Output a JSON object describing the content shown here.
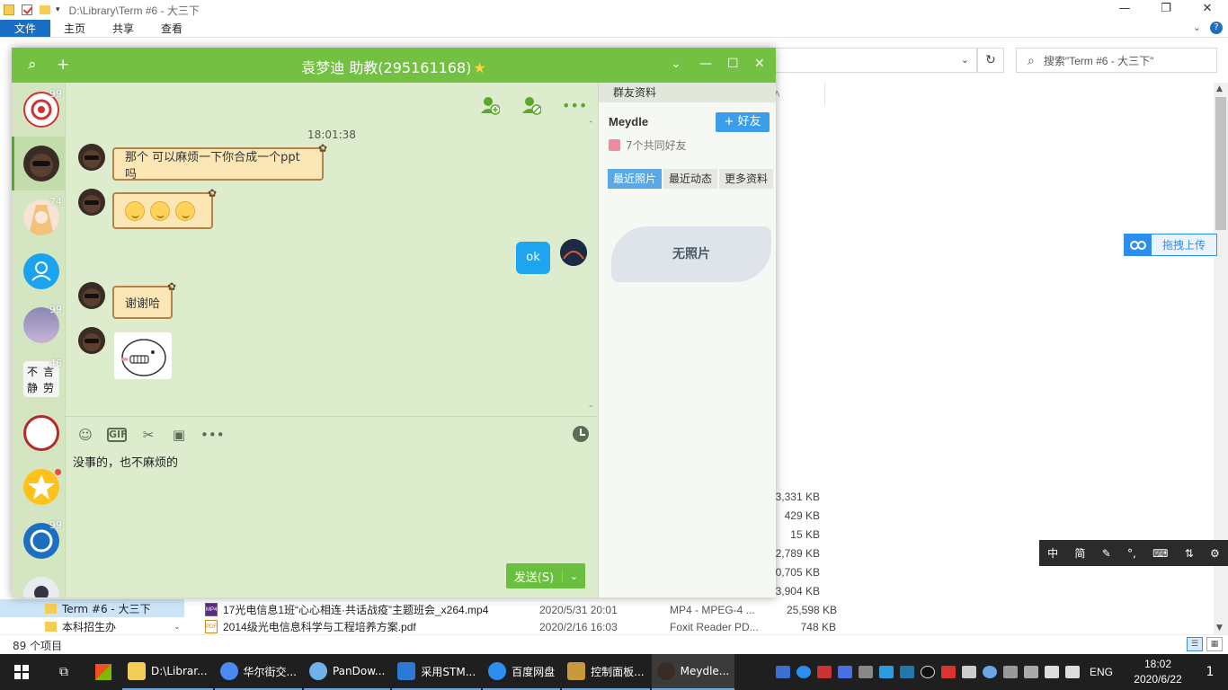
{
  "explorer": {
    "path": "D:\\Library\\Term #6 - 大三下",
    "ribbon_tabs": [
      "文件",
      "主页",
      "共享",
      "查看"
    ],
    "search_placeholder": "搜索\"Term #6 - 大三下\"",
    "col_fragment": "ﾍ",
    "sizes": [
      "3,331 KB",
      "429 KB",
      "15 KB",
      "2,789 KB",
      "0,705 KB",
      "3,904 KB"
    ],
    "tree": [
      "Term #6 - 大三下",
      "本科招生办"
    ],
    "files": [
      {
        "name": "17光电信息1班“心心相连·共话战疫”主题班会_x264.mp4",
        "date": "2020/5/31 20:01",
        "type": "MP4 - MPEG-4 ...",
        "size": "25,598 KB",
        "icon": "MP4"
      },
      {
        "name": "2014级光电信息科学与工程培养方案.pdf",
        "date": "2020/2/16 16:03",
        "type": "Foxit Reader PD...",
        "size": "748 KB",
        "icon": "PDF"
      }
    ],
    "status": "89 个项目",
    "upload_label": "拖拽上传"
  },
  "ime": [
    "中",
    "简",
    "✎",
    "°,",
    "⌨",
    "⇅",
    "⚙"
  ],
  "qq": {
    "title": "袁梦迪 助教(295161168)",
    "title_star": "★",
    "sidebar": [
      {
        "badge": "99",
        "color": "#c33"
      },
      {
        "badge": "",
        "color": "#3a2b24",
        "active": true
      },
      {
        "badge": "74",
        "color": "#f2c6b4"
      },
      {
        "badge": "",
        "color": "#1aa3ee"
      },
      {
        "badge": "99",
        "color": "#8a87b5"
      },
      {
        "badge": "46",
        "color": "#ddd"
      },
      {
        "badge": "",
        "color": "#b32a2a"
      },
      {
        "badge": "",
        "color": "#ffc21a",
        "dot": true
      },
      {
        "badge": "99",
        "color": "#1b6fc1"
      },
      {
        "badge": "",
        "color": "#334"
      }
    ],
    "timestamp": "18:01:38",
    "messages": {
      "m1": "那个 可以麻烦一下你合成一个ppt吗",
      "m3": "ok",
      "m4": "谢谢哈"
    },
    "input_text": "没事的，也不麻烦的",
    "send_label": "发送(S)",
    "profile": {
      "header": "群友资料",
      "name": "Meydle",
      "add_friend": "+ 好友",
      "mutual": "7个共同好友",
      "tabs": [
        "最近照片",
        "最近动态",
        "更多资料"
      ],
      "no_photo": "无照片"
    }
  },
  "taskbar": {
    "items": [
      {
        "label": "D:\\Librar...",
        "color": "#f3cd55"
      },
      {
        "label": "华尔街交...",
        "color": "#4a8af4"
      },
      {
        "label": "PanDow...",
        "color": "#6fb1e8"
      },
      {
        "label": "采用STM...",
        "color": "#2b7bd6"
      },
      {
        "label": "百度网盘",
        "color": "#2c8ff0"
      },
      {
        "label": "控制面板...",
        "color": "#c99a3b"
      },
      {
        "label": "Meydle...",
        "color": "#3a2b24",
        "active": true
      }
    ],
    "lang": "ENG",
    "time": "18:02",
    "date": "2020/6/22",
    "notif_count": "1"
  }
}
